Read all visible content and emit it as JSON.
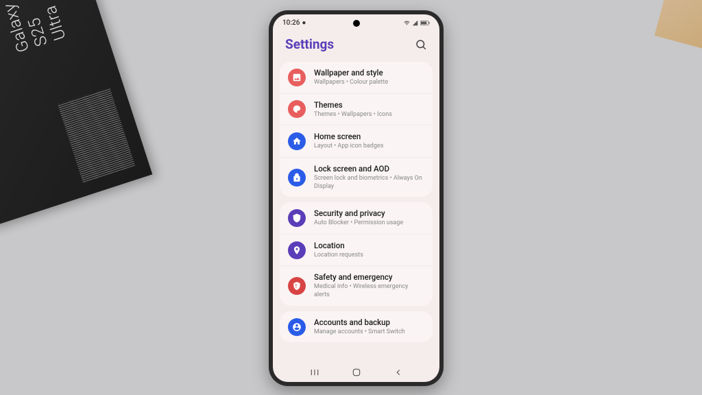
{
  "box_label": "Galaxy S25 Ultra",
  "status": {
    "time": "10:26",
    "icons_right": "📞 📶 🔋"
  },
  "header": {
    "title": "Settings"
  },
  "groups": [
    [
      {
        "icon": "wallpaper",
        "color": "#e85d5d",
        "title": "Wallpaper and style",
        "sub": "Wallpapers • Colour palette"
      },
      {
        "icon": "themes",
        "color": "#e85d5d",
        "title": "Themes",
        "sub": "Themes • Wallpapers • Icons"
      },
      {
        "icon": "home",
        "color": "#2b5ce8",
        "title": "Home screen",
        "sub": "Layout • App icon badges"
      },
      {
        "icon": "lock",
        "color": "#2b5ce8",
        "title": "Lock screen and AOD",
        "sub": "Screen lock and biometrics • Always On Display"
      }
    ],
    [
      {
        "icon": "shield",
        "color": "#5a3db8",
        "title": "Security and privacy",
        "sub": "Auto Blocker • Permission usage"
      },
      {
        "icon": "location",
        "color": "#5a3db8",
        "title": "Location",
        "sub": "Location requests"
      },
      {
        "icon": "safety",
        "color": "#d84444",
        "title": "Safety and emergency",
        "sub": "Medical info • Wireless emergency alerts"
      }
    ],
    [
      {
        "icon": "accounts",
        "color": "#2b5ce8",
        "title": "Accounts and backup",
        "sub": "Manage accounts • Smart Switch"
      }
    ]
  ]
}
